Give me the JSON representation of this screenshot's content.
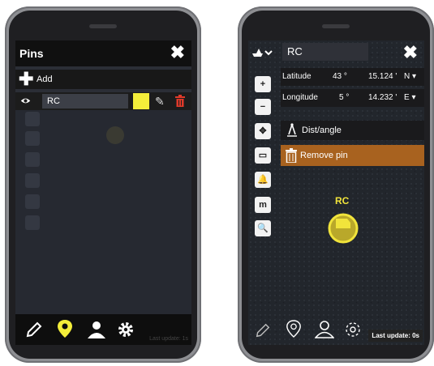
{
  "left_screen": {
    "header": {
      "title": "Pins",
      "close_label": "✖"
    },
    "add_label": "Add",
    "pin": {
      "name": "RC",
      "color": "#f4ee3a"
    },
    "bottom_bar": {
      "last_update": "Last update: 1s"
    },
    "icons": [
      "pencil-icon",
      "map-pin-icon",
      "user-icon",
      "gear-icon"
    ]
  },
  "right_screen": {
    "search_value": "RC",
    "close_label": "✖",
    "tools": [
      "+",
      "−",
      "✥",
      "▭",
      "🔔",
      "m",
      "🔍"
    ],
    "latitude": {
      "label": "Latitude",
      "degrees": "43 °",
      "minutes": "15.124 '",
      "hemisphere": "N"
    },
    "longitude": {
      "label": "Longitude",
      "degrees": "5 °",
      "minutes": "14.232 '",
      "hemisphere": "E"
    },
    "dist_angle_label": "Dist/angle",
    "remove_pin_label": "Remove pin",
    "pin_label": "RC",
    "last_update": "Last update: 0s",
    "colors": {
      "remove": "#a8621f",
      "pin": "#f1e43b"
    }
  }
}
